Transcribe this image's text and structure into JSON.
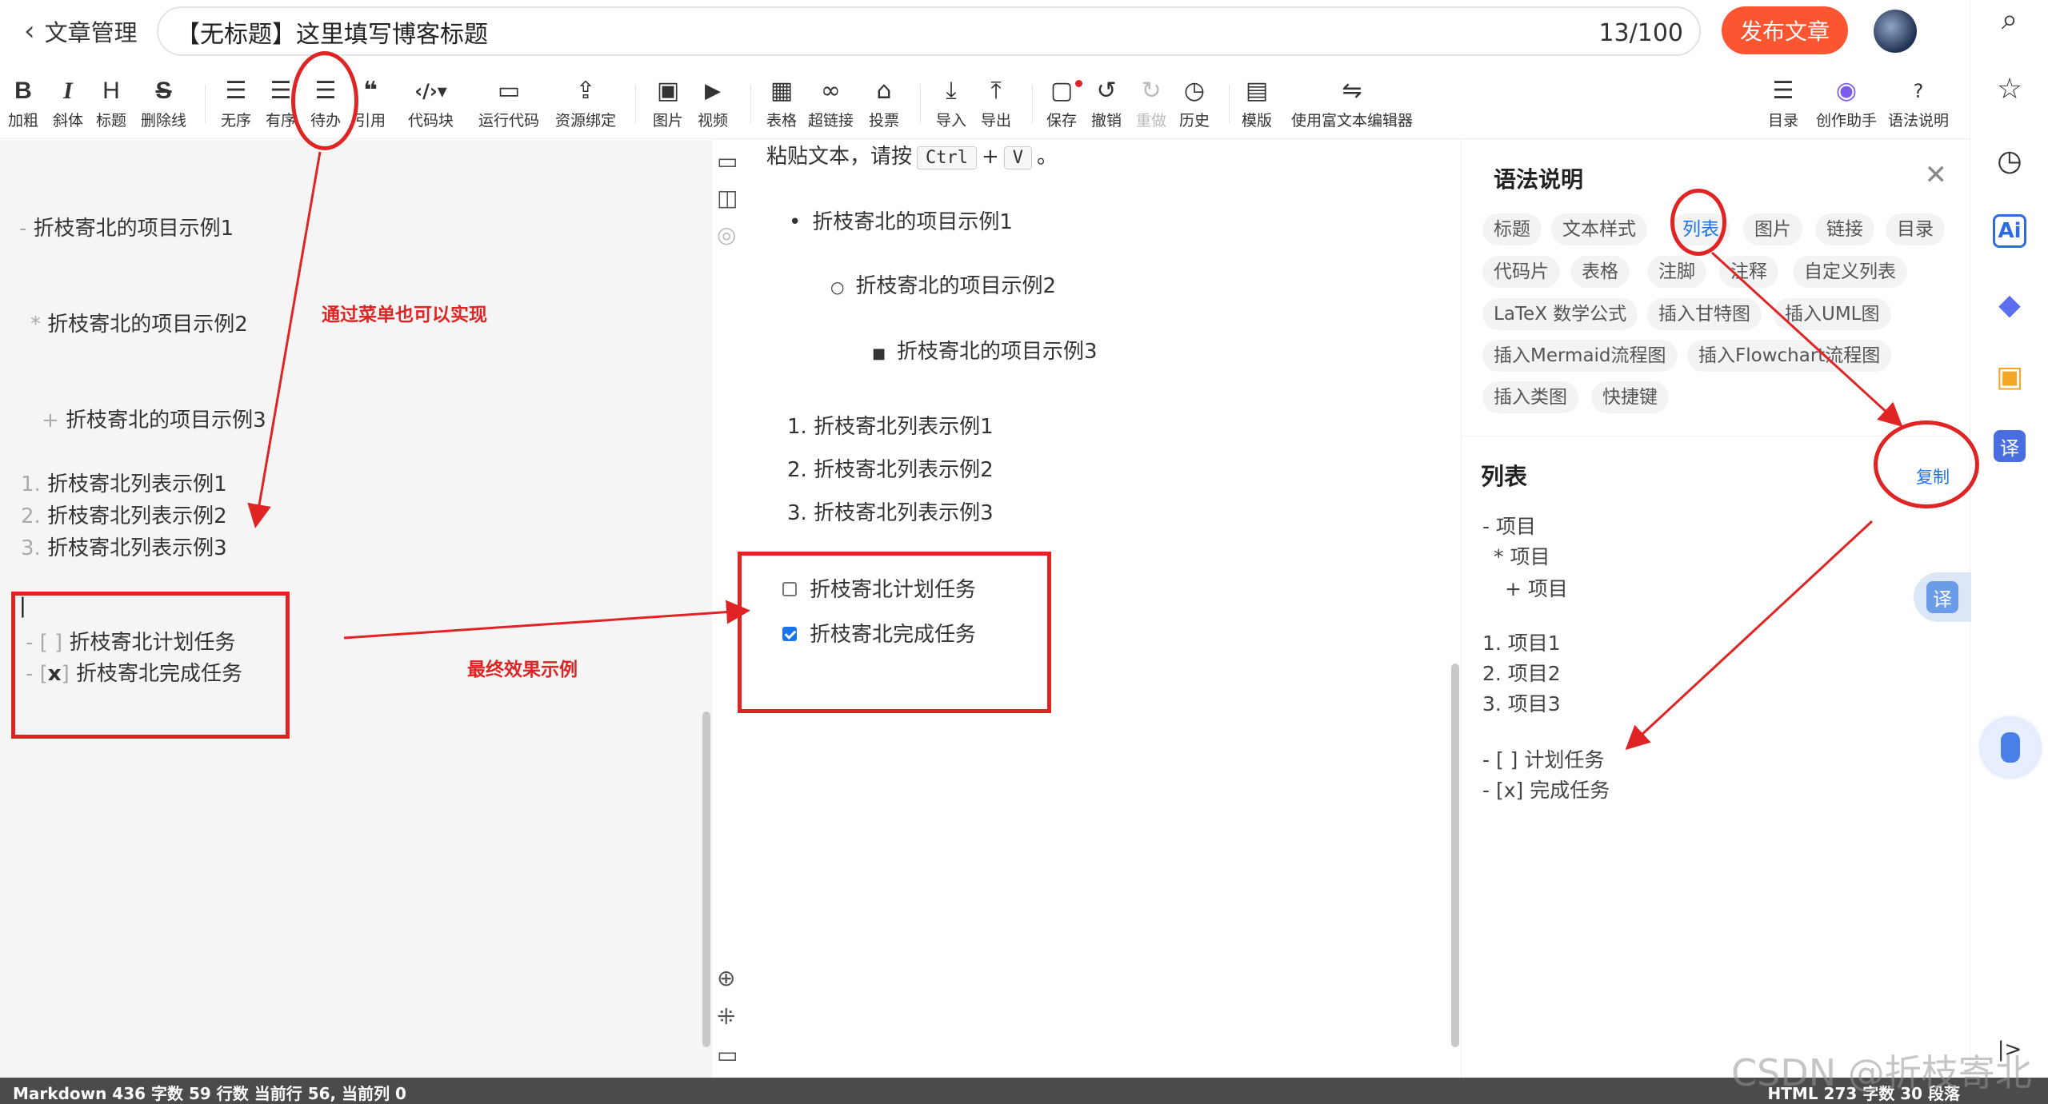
{
  "header": {
    "back_label": "文章管理",
    "title_value": "【无标题】这里填写博客标题",
    "title_count": "13/100",
    "publish_label": "发布文章"
  },
  "toolbar": {
    "bold": {
      "icon": "B",
      "label": "加粗"
    },
    "italic": {
      "icon": "I",
      "label": "斜体"
    },
    "heading": {
      "icon": "H",
      "label": "标题"
    },
    "strike": {
      "icon": "S",
      "label": "删除线"
    },
    "unordered": {
      "icon": "☰",
      "label": "无序"
    },
    "ordered": {
      "icon": "☰",
      "label": "有序"
    },
    "todo": {
      "icon": "☰",
      "label": "待办"
    },
    "quote": {
      "icon": "❝",
      "label": "引用"
    },
    "codeblock": {
      "icon": "‹/›▾",
      "label": "代码块"
    },
    "runcode": {
      "icon": "▭",
      "label": "运行代码"
    },
    "resource": {
      "icon": "⇪",
      "label": "资源绑定"
    },
    "image": {
      "icon": "▣",
      "label": "图片"
    },
    "video": {
      "icon": "▶",
      "label": "视频"
    },
    "table": {
      "icon": "▦",
      "label": "表格"
    },
    "link": {
      "icon": "∞",
      "label": "超链接"
    },
    "vote": {
      "icon": "⌂",
      "label": "投票"
    },
    "import": {
      "icon": "⤓",
      "label": "导入"
    },
    "export": {
      "icon": "⤒",
      "label": "导出"
    },
    "save": {
      "icon": "▢",
      "label": "保存"
    },
    "undo": {
      "icon": "↺",
      "label": "撤销"
    },
    "redo": {
      "icon": "↻",
      "label": "重做"
    },
    "history": {
      "icon": "◷",
      "label": "历史"
    },
    "template": {
      "icon": "▤",
      "label": "模版"
    },
    "richtext": {
      "icon": "⇋",
      "label": "使用富文本编辑器"
    },
    "toc": {
      "icon": "☰",
      "label": "目录"
    },
    "assistant": {
      "icon": "◉",
      "label": "创作助手"
    },
    "syntax": {
      "icon": "?",
      "label": "语法说明"
    }
  },
  "editor": {
    "line1_mark": "-",
    "line1_text": "折枝寄北的项目示例1",
    "line2_mark": "*",
    "line2_text": "折枝寄北的项目示例2",
    "line3_mark": "+",
    "line3_text": "折枝寄北的项目示例3",
    "ol1_mark": "1.",
    "ol1_text": "折枝寄北列表示例1",
    "ol2_mark": "2.",
    "ol2_text": "折枝寄北列表示例2",
    "ol3_mark": "3.",
    "ol3_text": "折枝寄北列表示例3",
    "cursor": "|",
    "task1_mark": "- [ ]",
    "task1_text": "折枝寄北计划任务",
    "task2_mark_dash": "- [",
    "task2_mark_x": "x",
    "task2_mark_end": "]",
    "task2_text": "折枝寄北完成任务"
  },
  "preview": {
    "paste_prefix": "粘贴文本，请按",
    "key_ctrl": "Ctrl",
    "plus": "+",
    "key_v": "V",
    "paste_suffix": "。",
    "ul1": "折枝寄北的项目示例1",
    "ul2": "折枝寄北的项目示例2",
    "ul3": "折枝寄北的项目示例3",
    "ol1_num": "1.",
    "ol1": "折枝寄北列表示例1",
    "ol2_num": "2.",
    "ol2": "折枝寄北列表示例2",
    "ol3_num": "3.",
    "ol3": "折枝寄北列表示例3",
    "task1": "折枝寄北计划任务",
    "task2": "折枝寄北完成任务"
  },
  "panel": {
    "title": "语法说明",
    "tags": [
      "标题",
      "文本样式",
      "列表",
      "图片",
      "链接",
      "目录",
      "代码片",
      "表格",
      "注脚",
      "注释",
      "自定义列表",
      "LaTeX 数学公式",
      "插入甘特图",
      "插入UML图",
      "插入Mermaid流程图",
      "插入Flowchart流程图",
      "插入类图",
      "快捷键"
    ],
    "list_heading": "列表",
    "copy_label": "复制",
    "code": [
      "- 项目",
      "* 项目",
      "+ 项目",
      "1. 项目1",
      "2. 项目2",
      "3. 项目3",
      "- [ ] 计划任务",
      "- [x] 完成任务"
    ]
  },
  "rail": {
    "translate_label": "译",
    "ai_label": "Ai",
    "collapse_label": "|>"
  },
  "annotations": {
    "menu_note": "通过菜单也可以实现",
    "effect_note": "最终效果示例"
  },
  "status": {
    "left": "Markdown  436 字数  59 行数  当前行 56, 当前列 0",
    "right": "HTML  273 字数  30 段落"
  },
  "watermark": "CSDN @折枝寄北",
  "colors": {
    "accent": "#fc5531",
    "link": "#1a73e8",
    "annotation": "#e02424"
  }
}
